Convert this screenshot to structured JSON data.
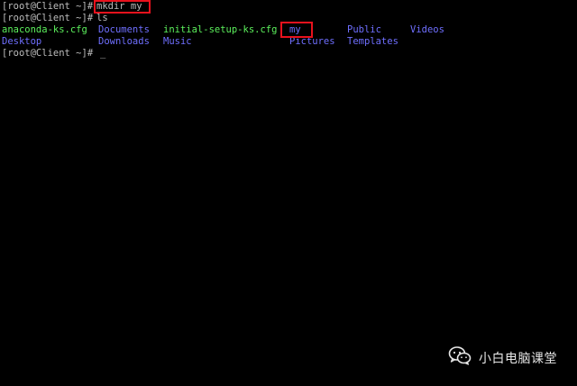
{
  "terminal": {
    "line1": {
      "prompt": "[root@Client ~]#",
      "command": "mkdir my"
    },
    "line2": {
      "prompt": "[root@Client ~]#",
      "command": "ls"
    },
    "listing": {
      "row1": [
        "anaconda-ks.cfg",
        "Documents",
        "initial-setup-ks.cfg",
        "my",
        "Public",
        "Videos"
      ],
      "row2": [
        "Desktop",
        "Downloads",
        "Music",
        "Pictures",
        "Templates"
      ]
    },
    "line5": {
      "prompt": "[root@Client ~]#",
      "cursor": "_"
    }
  },
  "watermark": {
    "text": "小白电脑课堂",
    "icon": "wechat-icon"
  },
  "colors": {
    "background": "#000000",
    "text": "#bdbdbd",
    "file": "#5cf05c",
    "directory": "#6f6fff",
    "highlight": "#e8121d"
  }
}
